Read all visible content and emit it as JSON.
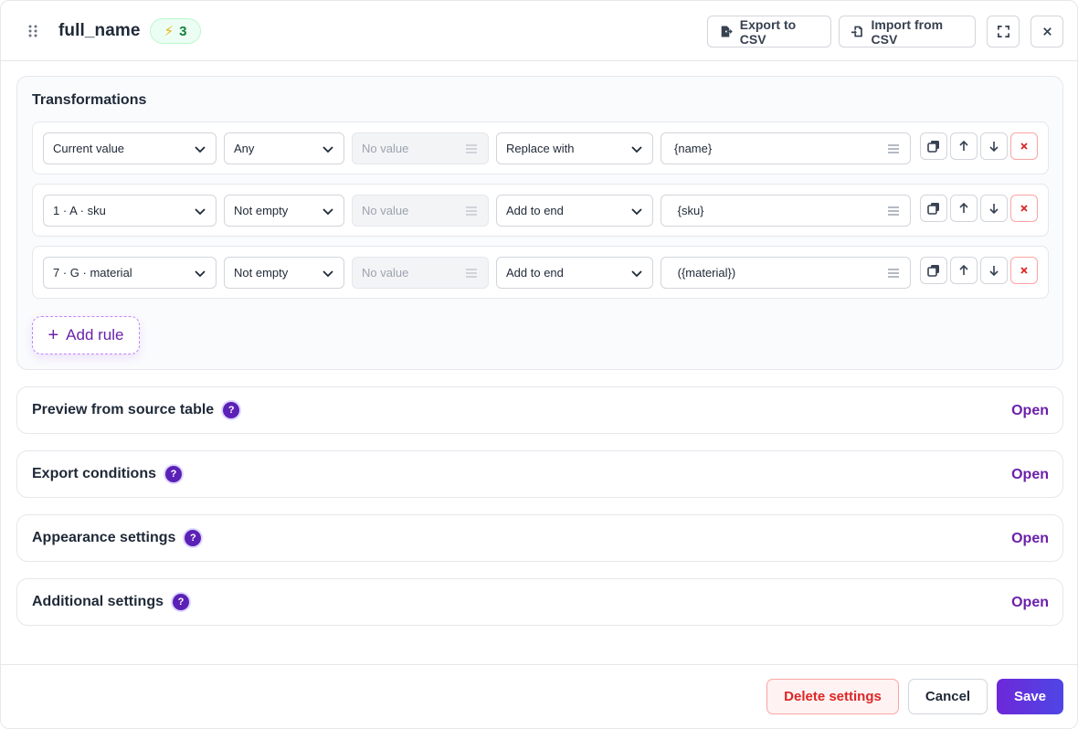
{
  "header": {
    "title": "full_name",
    "badge_count": "3",
    "export_label": "Export to CSV",
    "import_label": "Import from CSV"
  },
  "transformations": {
    "title": "Transformations",
    "rules": [
      {
        "source": "Current value",
        "condition": "Any",
        "value_placeholder": "No value",
        "action": "Replace with",
        "text": "{name}"
      },
      {
        "source": "1 · A · sku",
        "condition": "Not empty",
        "value_placeholder": "No value",
        "action": "Add to end",
        "text": " {sku}"
      },
      {
        "source": "7 · G · material",
        "condition": "Not empty",
        "value_placeholder": "No value",
        "action": "Add to end",
        "text": " ({material})"
      }
    ],
    "add_rule_label": "Add rule"
  },
  "sections": [
    {
      "title": "Preview from source table",
      "action": "Open"
    },
    {
      "title": "Export conditions",
      "action": "Open"
    },
    {
      "title": "Appearance settings",
      "action": "Open"
    },
    {
      "title": "Additional settings",
      "action": "Open"
    }
  ],
  "footer": {
    "delete_label": "Delete settings",
    "cancel_label": "Cancel",
    "save_label": "Save"
  },
  "colors": {
    "accent": "#6b21a8",
    "primary_gradient_start": "#6d28d9",
    "primary_gradient_end": "#4f46e5",
    "danger": "#dc2626",
    "badge_green": "#15803d"
  }
}
